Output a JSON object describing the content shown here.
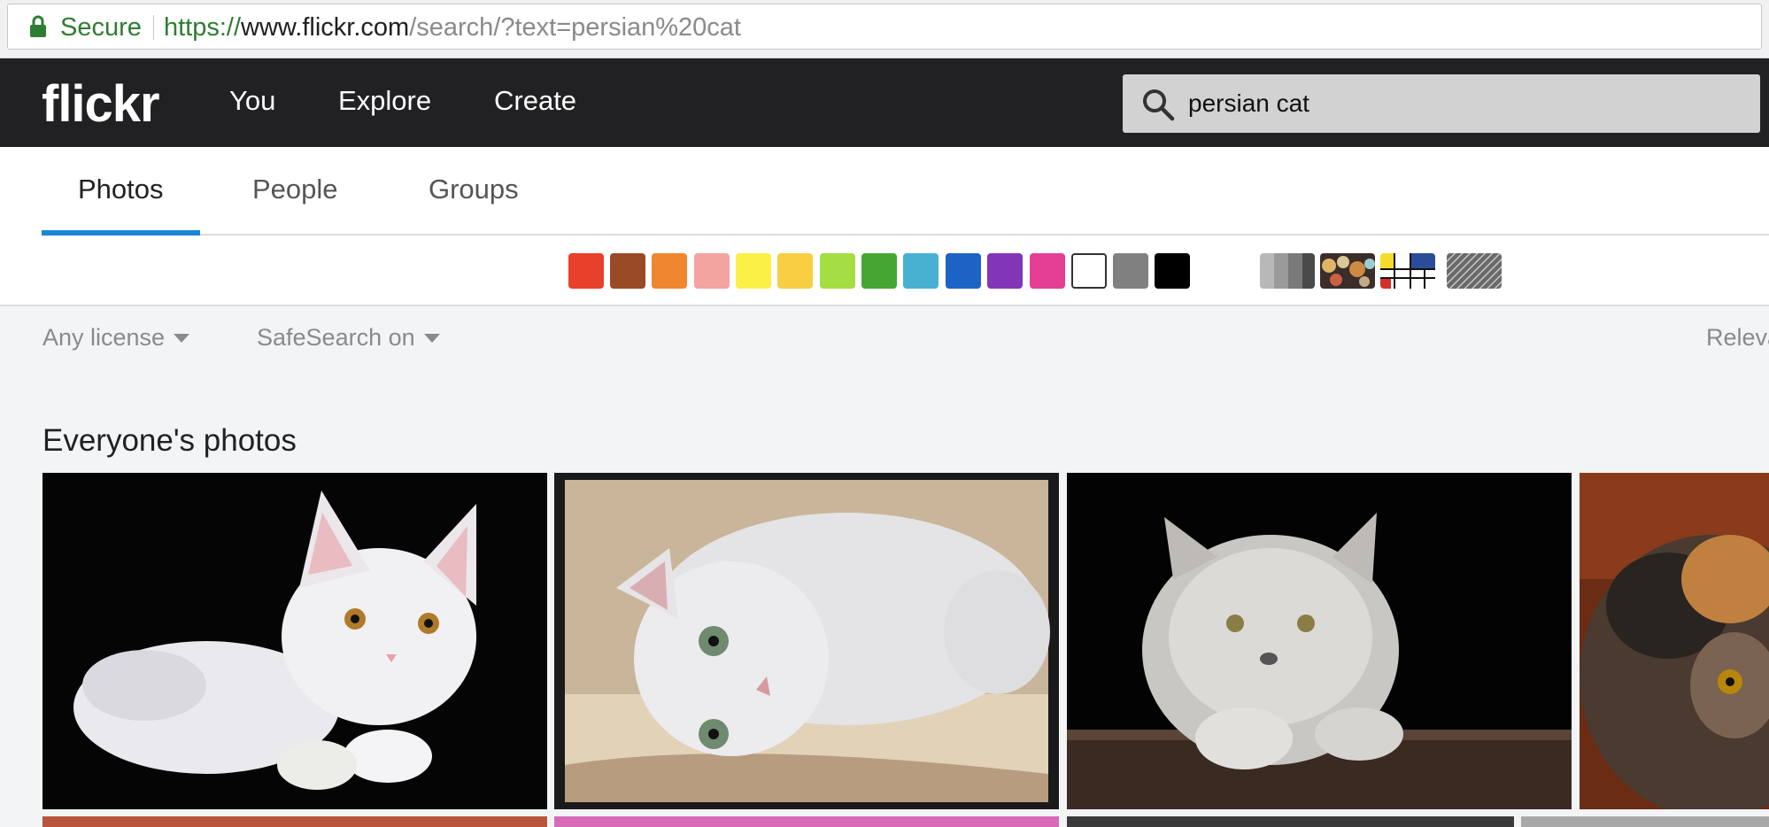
{
  "browser": {
    "secure_label": "Secure",
    "url_scheme": "https://",
    "url_host": "www.flickr.com",
    "url_path": "/search/?text=persian%20cat"
  },
  "nav": {
    "logo": "flickr",
    "links": [
      "You",
      "Explore",
      "Create"
    ],
    "search_value": "persian cat"
  },
  "tabs": [
    {
      "label": "Photos",
      "active": true
    },
    {
      "label": "People",
      "active": false
    },
    {
      "label": "Groups",
      "active": false
    }
  ],
  "colors": [
    "#e8402a",
    "#9a4a25",
    "#f0862f",
    "#f3a3a0",
    "#fbf045",
    "#f8cf43",
    "#a5de42",
    "#46a634",
    "#48b1d2",
    "#1c63c5",
    "#8136b8",
    "#e53e95",
    "#ffffff",
    "#808080",
    "#000000"
  ],
  "patterns": [
    "black-and-white",
    "shallow-depth-of-field",
    "minimalist",
    "pattern"
  ],
  "filters": {
    "license": "Any license",
    "safesearch": "SafeSearch on",
    "sort": "Relevant"
  },
  "section_title": "Everyone's photos",
  "photos": [
    {
      "alt": "white kitten on black background"
    },
    {
      "alt": "white persian cat lying on carpet"
    },
    {
      "alt": "grey persian cat on dark background"
    },
    {
      "alt": "tortoiseshell persian cat"
    }
  ]
}
